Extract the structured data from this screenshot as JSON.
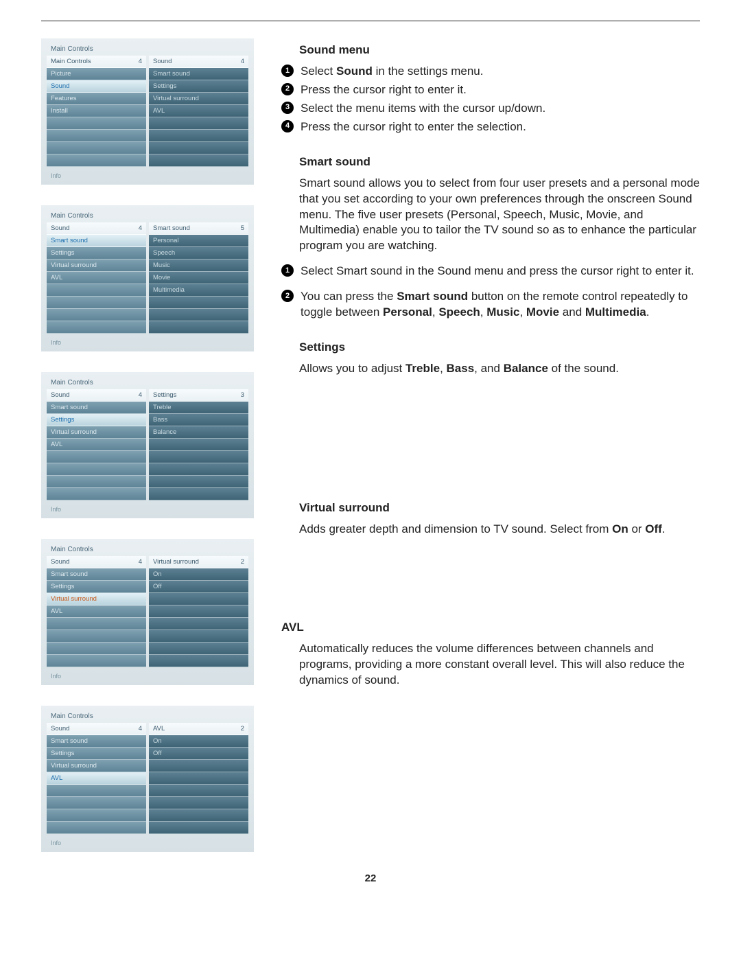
{
  "page_number": "22",
  "menus": [
    {
      "title": "Main Controls",
      "left": {
        "head_label": "Main Controls",
        "head_count": "4",
        "items": [
          {
            "label": "Picture",
            "style": "row"
          },
          {
            "label": "Sound",
            "style": "sel"
          },
          {
            "label": "Features",
            "style": "row"
          },
          {
            "label": "Install",
            "style": "row"
          },
          {
            "label": "",
            "style": "empty"
          },
          {
            "label": "",
            "style": "empty"
          },
          {
            "label": "",
            "style": "empty"
          },
          {
            "label": "",
            "style": "empty"
          }
        ]
      },
      "right": {
        "head_label": "Sound",
        "head_count": "4",
        "items": [
          {
            "label": "Smart sound",
            "style": "dark"
          },
          {
            "label": "Settings",
            "style": "dark"
          },
          {
            "label": "Virtual surround",
            "style": "dark"
          },
          {
            "label": "AVL",
            "style": "dark"
          },
          {
            "label": "",
            "style": "dark-empty"
          },
          {
            "label": "",
            "style": "dark-empty"
          },
          {
            "label": "",
            "style": "dark-empty"
          },
          {
            "label": "",
            "style": "dark-empty"
          }
        ]
      },
      "info": "Info"
    },
    {
      "title": "Main Controls",
      "left": {
        "head_label": "Sound",
        "head_count": "4",
        "items": [
          {
            "label": "Smart sound",
            "style": "sel"
          },
          {
            "label": "Settings",
            "style": "row"
          },
          {
            "label": "Virtual surround",
            "style": "row"
          },
          {
            "label": "AVL",
            "style": "row"
          },
          {
            "label": "",
            "style": "empty"
          },
          {
            "label": "",
            "style": "empty"
          },
          {
            "label": "",
            "style": "empty"
          },
          {
            "label": "",
            "style": "empty"
          }
        ]
      },
      "right": {
        "head_label": "Smart sound",
        "head_count": "5",
        "items": [
          {
            "label": "Personal",
            "style": "dark"
          },
          {
            "label": "Speech",
            "style": "dark"
          },
          {
            "label": "Music",
            "style": "dark"
          },
          {
            "label": "Movie",
            "style": "dark"
          },
          {
            "label": "Multimedia",
            "style": "dark"
          },
          {
            "label": "",
            "style": "dark-empty"
          },
          {
            "label": "",
            "style": "dark-empty"
          },
          {
            "label": "",
            "style": "dark-empty"
          }
        ]
      },
      "info": "Info"
    },
    {
      "title": "Main Controls",
      "left": {
        "head_label": "Sound",
        "head_count": "4",
        "items": [
          {
            "label": "Smart sound",
            "style": "row"
          },
          {
            "label": "Settings",
            "style": "sel"
          },
          {
            "label": "Virtual surround",
            "style": "row"
          },
          {
            "label": "AVL",
            "style": "row"
          },
          {
            "label": "",
            "style": "empty"
          },
          {
            "label": "",
            "style": "empty"
          },
          {
            "label": "",
            "style": "empty"
          },
          {
            "label": "",
            "style": "empty"
          }
        ]
      },
      "right": {
        "head_label": "Settings",
        "head_count": "3",
        "items": [
          {
            "label": "Treble",
            "style": "dark"
          },
          {
            "label": "Bass",
            "style": "dark"
          },
          {
            "label": "Balance",
            "style": "dark"
          },
          {
            "label": "",
            "style": "dark-empty"
          },
          {
            "label": "",
            "style": "dark-empty"
          },
          {
            "label": "",
            "style": "dark-empty"
          },
          {
            "label": "",
            "style": "dark-empty"
          },
          {
            "label": "",
            "style": "dark-empty"
          }
        ]
      },
      "info": "Info"
    },
    {
      "title": "Main Controls",
      "left": {
        "head_label": "Sound",
        "head_count": "4",
        "items": [
          {
            "label": "Smart sound",
            "style": "row"
          },
          {
            "label": "Settings",
            "style": "row"
          },
          {
            "label": "Virtual surround",
            "style": "sel-orange"
          },
          {
            "label": "AVL",
            "style": "row"
          },
          {
            "label": "",
            "style": "empty"
          },
          {
            "label": "",
            "style": "empty"
          },
          {
            "label": "",
            "style": "empty"
          },
          {
            "label": "",
            "style": "empty"
          }
        ]
      },
      "right": {
        "head_label": "Virtual surround",
        "head_count": "2",
        "items": [
          {
            "label": "On",
            "style": "dark"
          },
          {
            "label": "Off",
            "style": "dark"
          },
          {
            "label": "",
            "style": "dark-empty"
          },
          {
            "label": "",
            "style": "dark-empty"
          },
          {
            "label": "",
            "style": "dark-empty"
          },
          {
            "label": "",
            "style": "dark-empty"
          },
          {
            "label": "",
            "style": "dark-empty"
          },
          {
            "label": "",
            "style": "dark-empty"
          }
        ]
      },
      "info": "Info"
    },
    {
      "title": "Main Controls",
      "left": {
        "head_label": "Sound",
        "head_count": "4",
        "items": [
          {
            "label": "Smart sound",
            "style": "row"
          },
          {
            "label": "Settings",
            "style": "row"
          },
          {
            "label": "Virtual surround",
            "style": "row"
          },
          {
            "label": "AVL",
            "style": "sel"
          },
          {
            "label": "",
            "style": "empty"
          },
          {
            "label": "",
            "style": "empty"
          },
          {
            "label": "",
            "style": "empty"
          },
          {
            "label": "",
            "style": "empty"
          }
        ]
      },
      "right": {
        "head_label": "AVL",
        "head_count": "2",
        "items": [
          {
            "label": "On",
            "style": "dark"
          },
          {
            "label": "Off",
            "style": "dark"
          },
          {
            "label": "",
            "style": "dark-empty"
          },
          {
            "label": "",
            "style": "dark-empty"
          },
          {
            "label": "",
            "style": "dark-empty"
          },
          {
            "label": "",
            "style": "dark-empty"
          },
          {
            "label": "",
            "style": "dark-empty"
          },
          {
            "label": "",
            "style": "dark-empty"
          }
        ]
      },
      "info": "Info"
    }
  ],
  "text": {
    "h_sound_menu": "Sound menu",
    "steps": [
      {
        "pre": "Select ",
        "bold": "Sound",
        "post": " in the settings menu."
      },
      {
        "pre": "Press the cursor right to enter it.",
        "bold": "",
        "post": ""
      },
      {
        "pre": "Select the menu items with the cursor up/down.",
        "bold": "",
        "post": ""
      },
      {
        "pre": "Press the cursor right to enter the selection.",
        "bold": "",
        "post": ""
      }
    ],
    "h_smart": "Smart sound",
    "smart_para": "Smart sound allows you to select from four user presets and a personal mode that you set according to your own preferences through the onscreen Sound menu.  The five user presets (Personal, Speech, Music, Movie, and Multimedia) enable you to tailor the TV sound so as to enhance the particular program you are watching.",
    "smart_b1": "Select Smart sound in the Sound menu and press the cursor right to enter it.",
    "smart_b2_a": "You can press the ",
    "smart_b2_b": "Smart sound",
    "smart_b2_c": " button on the remote control repeatedly to toggle between ",
    "smart_b2_d": "Personal",
    "smart_b2_e": "Speech",
    "smart_b2_f": "Music",
    "smart_b2_g": "Movie",
    "smart_b2_h": "Multimedia",
    "h_settings": "Settings",
    "settings_a": "Allows you to adjust ",
    "settings_b": "Treble",
    "settings_c": "Bass",
    "settings_d": "Balance",
    "settings_e": " of the sound.",
    "h_vs": "Virtual surround",
    "vs_a": "Adds greater depth and dimension to TV sound.  Select from ",
    "vs_b": "On",
    "vs_c": "Off",
    "h_avl": "AVL",
    "avl_para": "Automatically reduces the volume differences between channels and programs, providing a more constant overall level.  This will also reduce the dynamics of sound."
  }
}
